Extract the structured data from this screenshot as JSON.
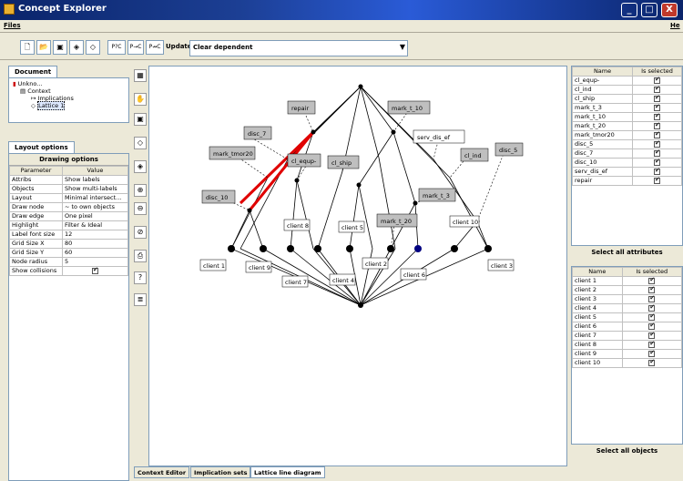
{
  "window": {
    "title": "Concept Explorer"
  },
  "menu": {
    "files": "Files",
    "help": "He"
  },
  "toolbar": {
    "buttons": [
      "P?C",
      "P→C",
      "P↛C"
    ],
    "update_label": "Update:",
    "update_value": "Clear dependent"
  },
  "document": {
    "tab": "Document",
    "tree": [
      "Unkno...",
      "Context",
      "Implications",
      "Lattice 1"
    ]
  },
  "layout_tabs": {
    "layout": "Layout options",
    "drawing": "Drawing options"
  },
  "params": {
    "header": [
      "Parameter",
      "Value"
    ],
    "rows": [
      [
        "Attribs",
        "Show labels"
      ],
      [
        "Objects",
        "Show multi-labels"
      ],
      [
        "Layout",
        "Minimal intersect..."
      ],
      [
        "Draw node",
        "~ to own objects"
      ],
      [
        "Draw edge",
        "One pixel"
      ],
      [
        "Highlight",
        "Filter & Ideal"
      ],
      [
        "Label font size",
        "12"
      ],
      [
        "Grid Size X",
        "80"
      ],
      [
        "Grid Size Y",
        "60"
      ],
      [
        "Node radius",
        "5"
      ],
      [
        "Show collisions",
        ""
      ]
    ]
  },
  "attributes": {
    "header": [
      "Name",
      "Is selected"
    ],
    "items": [
      "cl_equp-",
      "cl_ind",
      "cl_ship",
      "mark_t_3",
      "mark_t_10",
      "mark_t_20",
      "mark_tmor20",
      "disc_5",
      "disc_7",
      "disc_10",
      "serv_dis_ef",
      "repair"
    ],
    "select_all": "Select all attributes"
  },
  "objects": {
    "header": [
      "Name",
      "Is selected"
    ],
    "items": [
      "client 1",
      "client 2",
      "client 3",
      "client 4",
      "client 5",
      "client 6",
      "client 7",
      "client 8",
      "client 9",
      "client 10"
    ],
    "select_all": "Select all objects"
  },
  "bottom_tabs": [
    "Context Editor",
    "Implication sets",
    "Lattice line diagram"
  ],
  "lattice": {
    "attribute_labels": [
      "repair",
      "mark_t_10",
      "disc_7",
      "serv_dis_ef",
      "mark_tmor20",
      "cl_equp-",
      "cl_ship",
      "cl_ind",
      "disc_5",
      "disc_10",
      "mark_t_3",
      "mark_t_20",
      "client 8",
      "client 5",
      "client 10"
    ],
    "object_labels": [
      "client 1",
      "client 9",
      "client 7",
      "client 4",
      "client 2",
      "client 6",
      "client 3"
    ]
  },
  "colors": {
    "highlight": "#e00000",
    "title_bar": "#0a246a",
    "selected_node": "#000080"
  }
}
